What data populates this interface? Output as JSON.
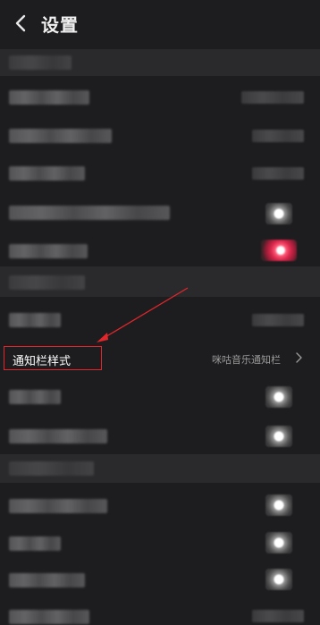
{
  "header": {
    "title": "设置",
    "back_icon": "chevron-left-icon"
  },
  "notification_row": {
    "label": "通知栏样式",
    "value": "咪咕音乐通知栏",
    "chevron_icon": "chevron-right-icon"
  },
  "colors": {
    "background": "#1d1d1f",
    "section_bar": "#2a2a2c",
    "highlight": "#e2262b",
    "toggle_on": "#d8264a"
  }
}
